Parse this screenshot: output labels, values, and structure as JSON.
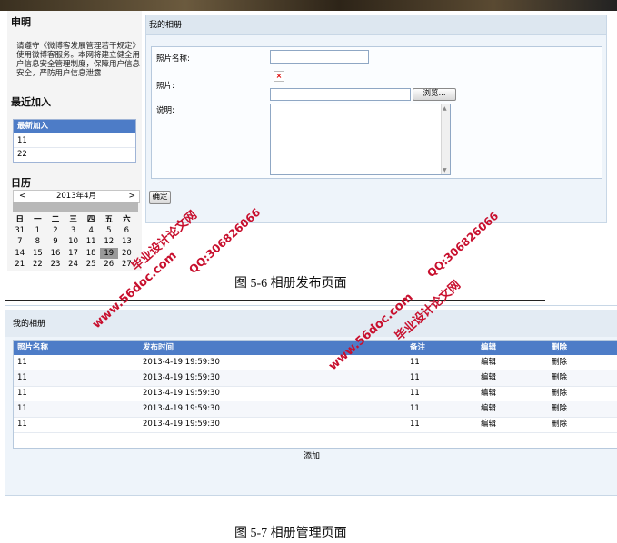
{
  "figure1": {
    "sidebar": {
      "notice_title": "申明",
      "notice_text": "请遵守《微博客发展管理若干规定》使用微博客服务。本网将建立健全用户信息安全管理制度，保障用户信息安全，严防用户信息泄露",
      "recent_title": "最近加入",
      "recent_header": "最新加入",
      "recent_items": [
        "11",
        "22"
      ],
      "calendar_title": "日历",
      "calendar": {
        "prev": "<",
        "next": ">",
        "month": "2013年4月",
        "weekdays": [
          "日",
          "一",
          "二",
          "三",
          "四",
          "五",
          "六"
        ],
        "weeks": [
          [
            "31",
            "1",
            "2",
            "3",
            "4",
            "5",
            "6"
          ],
          [
            "7",
            "8",
            "9",
            "10",
            "11",
            "12",
            "13"
          ],
          [
            "14",
            "15",
            "16",
            "17",
            "18",
            "19",
            "20"
          ],
          [
            "21",
            "22",
            "23",
            "24",
            "25",
            "26",
            "27"
          ]
        ],
        "selected": "19"
      }
    },
    "panel_title": "我的相册",
    "form": {
      "name_label": "照片名称:",
      "photo_label": "照片:",
      "broken_image": "×",
      "browse_label": "浏览...",
      "desc_label": "说明:"
    },
    "confirm_label": "确定",
    "caption": "图 5-6 相册发布页面"
  },
  "figure2": {
    "panel_title": "我的相册",
    "columns": [
      "照片名称",
      "发布时间",
      "备注",
      "编辑",
      "删除"
    ],
    "rows": [
      [
        "11",
        "2013-4-19 19:59:30",
        "11",
        "编辑",
        "删除"
      ],
      [
        "11",
        "2013-4-19 19:59:30",
        "11",
        "编辑",
        "删除"
      ],
      [
        "11",
        "2013-4-19 19:59:30",
        "11",
        "编辑",
        "删除"
      ],
      [
        "11",
        "2013-4-19 19:59:30",
        "11",
        "编辑",
        "删除"
      ],
      [
        "11",
        "2013-4-19 19:59:30",
        "11",
        "编辑",
        "删除"
      ]
    ],
    "add_label": "添加",
    "caption": "图 5-7 相册管理页面"
  },
  "watermark": {
    "site": "www.56doc.com",
    "qq": "QQ:306826066",
    "brand": "毕业设计论文网"
  },
  "colors": {
    "header_blue": "#4d7cc7",
    "watermark_red": "#c8102e",
    "panel_bg": "#eef4fa"
  }
}
